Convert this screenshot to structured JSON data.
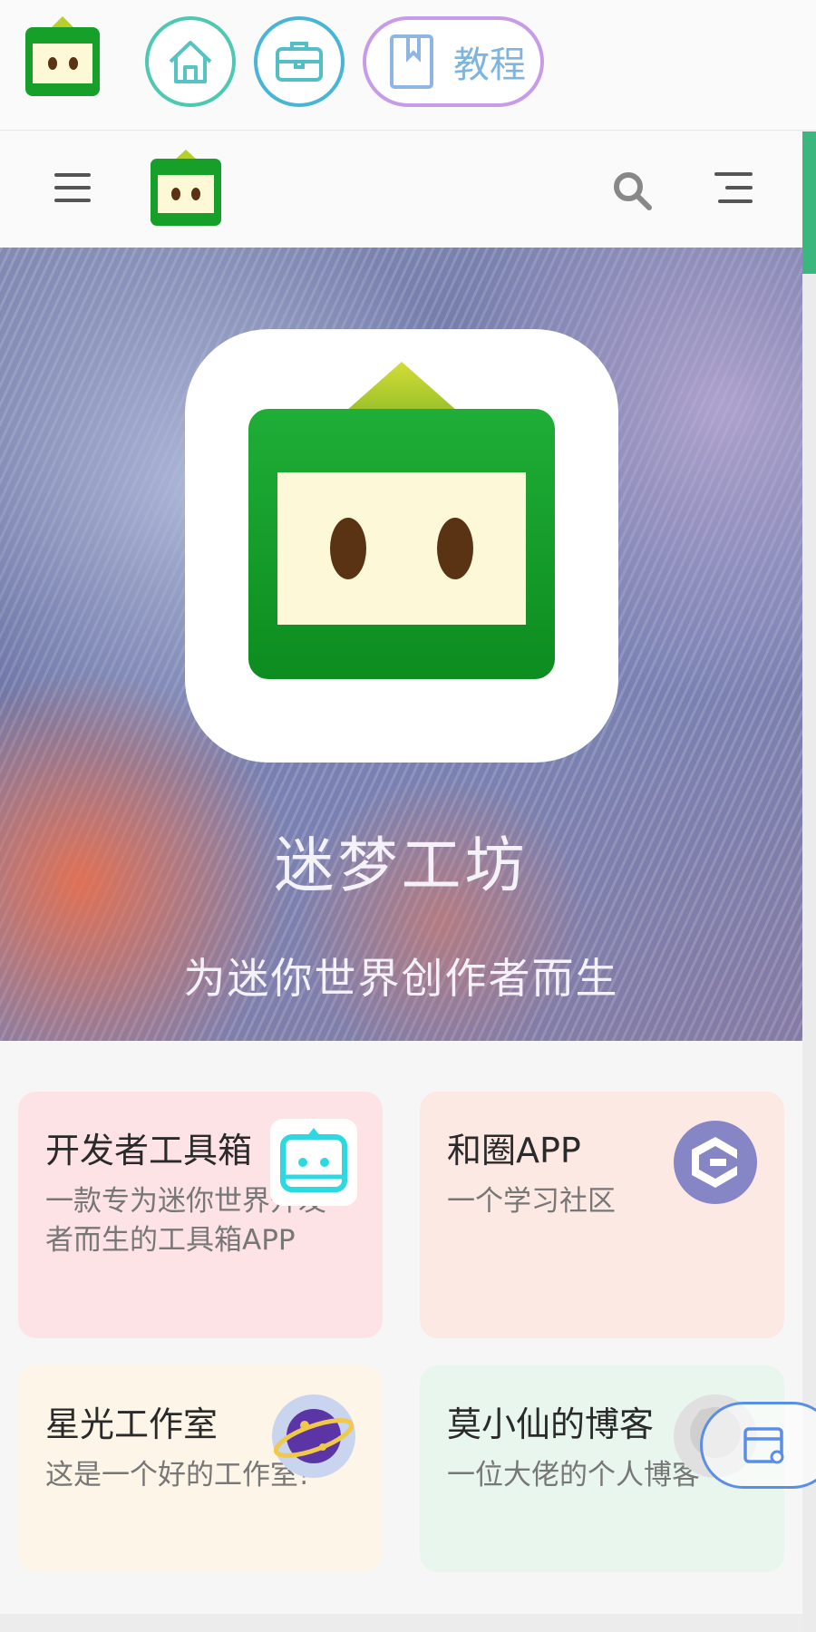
{
  "topbar": {
    "tutorial_label": "教程"
  },
  "hero": {
    "title": "迷梦工坊",
    "subtitle": "为迷你世界创作者而生"
  },
  "cards": [
    {
      "title": "开发者工具箱",
      "description": "一款专为迷你世界开发者而生的工具箱APP",
      "icon": "robot-icon"
    },
    {
      "title": "和圈APP",
      "description": "一个学习社区",
      "icon": "hequan-logo-icon"
    },
    {
      "title": "星光工作室",
      "description": "这是一个好的工作室!",
      "icon": "planet-icon"
    },
    {
      "title": "莫小仙的博客",
      "description": "一位大佬的个人博客",
      "icon": "avatar-icon"
    }
  ],
  "colors": {
    "accent_green": "#3bb77e",
    "logo_green": "#1f9e2e",
    "card_pink": "#fde3e5",
    "card_peach": "#fde9e4",
    "card_cream": "#fdf5e7",
    "card_mint": "#e8f6ee"
  }
}
